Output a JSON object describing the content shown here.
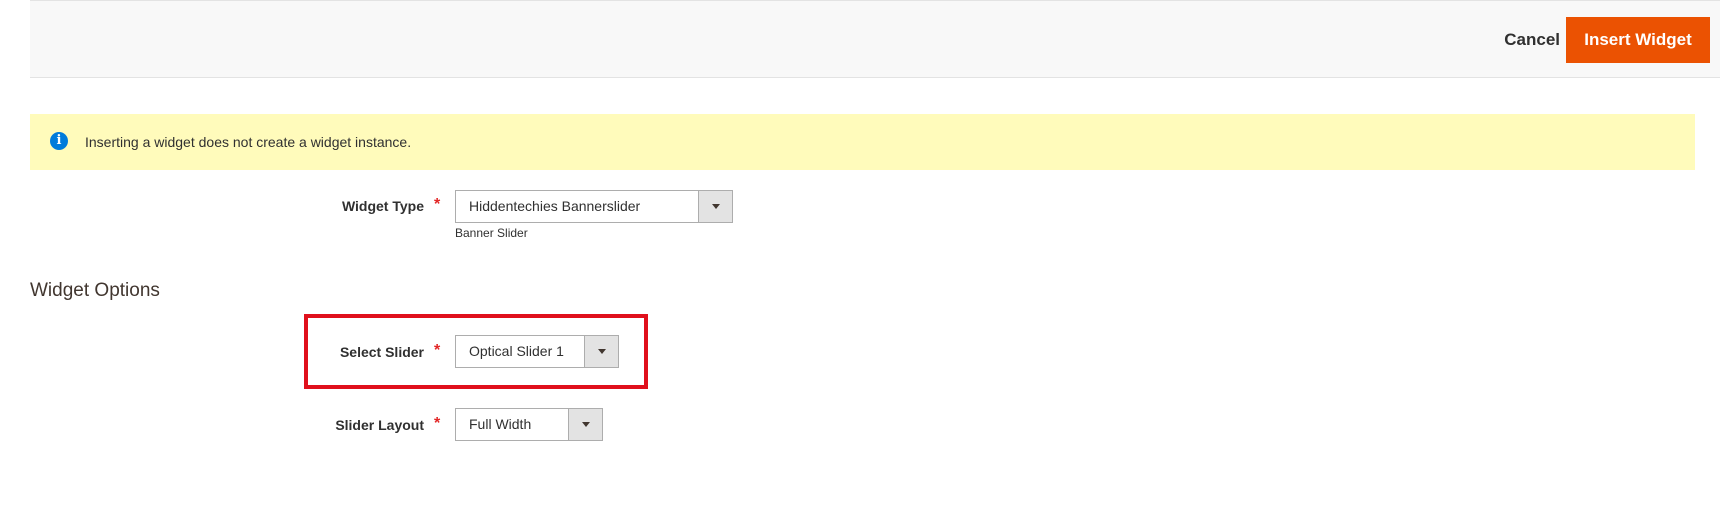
{
  "header": {
    "cancel_label": "Cancel",
    "insert_label": "Insert Widget"
  },
  "notice": {
    "text": "Inserting a widget does not create a widget instance.",
    "icon": "info-icon"
  },
  "widget_type": {
    "label": "Widget Type",
    "required_mark": "*",
    "value": "Hiddentechies Bannerslider",
    "note": "Banner Slider"
  },
  "widget_options": {
    "title": "Widget Options",
    "select_slider": {
      "label": "Select Slider",
      "required_mark": "*",
      "value": "Optical Slider 1"
    },
    "slider_layout": {
      "label": "Slider Layout",
      "required_mark": "*",
      "value": "Full Width"
    }
  },
  "colors": {
    "accent": "#eb5202",
    "notice_bg": "#fffbbb",
    "info_icon": "#007bdb",
    "required": "#e22626",
    "highlight": "#e0101c"
  }
}
